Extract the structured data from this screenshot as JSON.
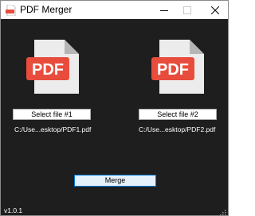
{
  "window": {
    "title": "PDF Merger",
    "controls": [
      "minimize",
      "maximize",
      "close"
    ]
  },
  "files": [
    {
      "icon": "pdf-file-icon",
      "icon_text": "PDF",
      "button_label": "Select file #1",
      "path": "C:/Use...esktop/PDF1.pdf"
    },
    {
      "icon": "pdf-file-icon",
      "icon_text": "PDF",
      "button_label": "Select file #2",
      "path": "C:/Use...esktop/PDF2.pdf"
    }
  ],
  "actions": {
    "merge_label": "Merge"
  },
  "footer": {
    "version": "v1.0.1"
  },
  "colors": {
    "background": "#1e1e1e",
    "pdf_badge": "#e84c3d",
    "pdf_page": "#ececec",
    "merge_button_bg": "#e5f1fb",
    "merge_button_border": "#0078d7"
  }
}
